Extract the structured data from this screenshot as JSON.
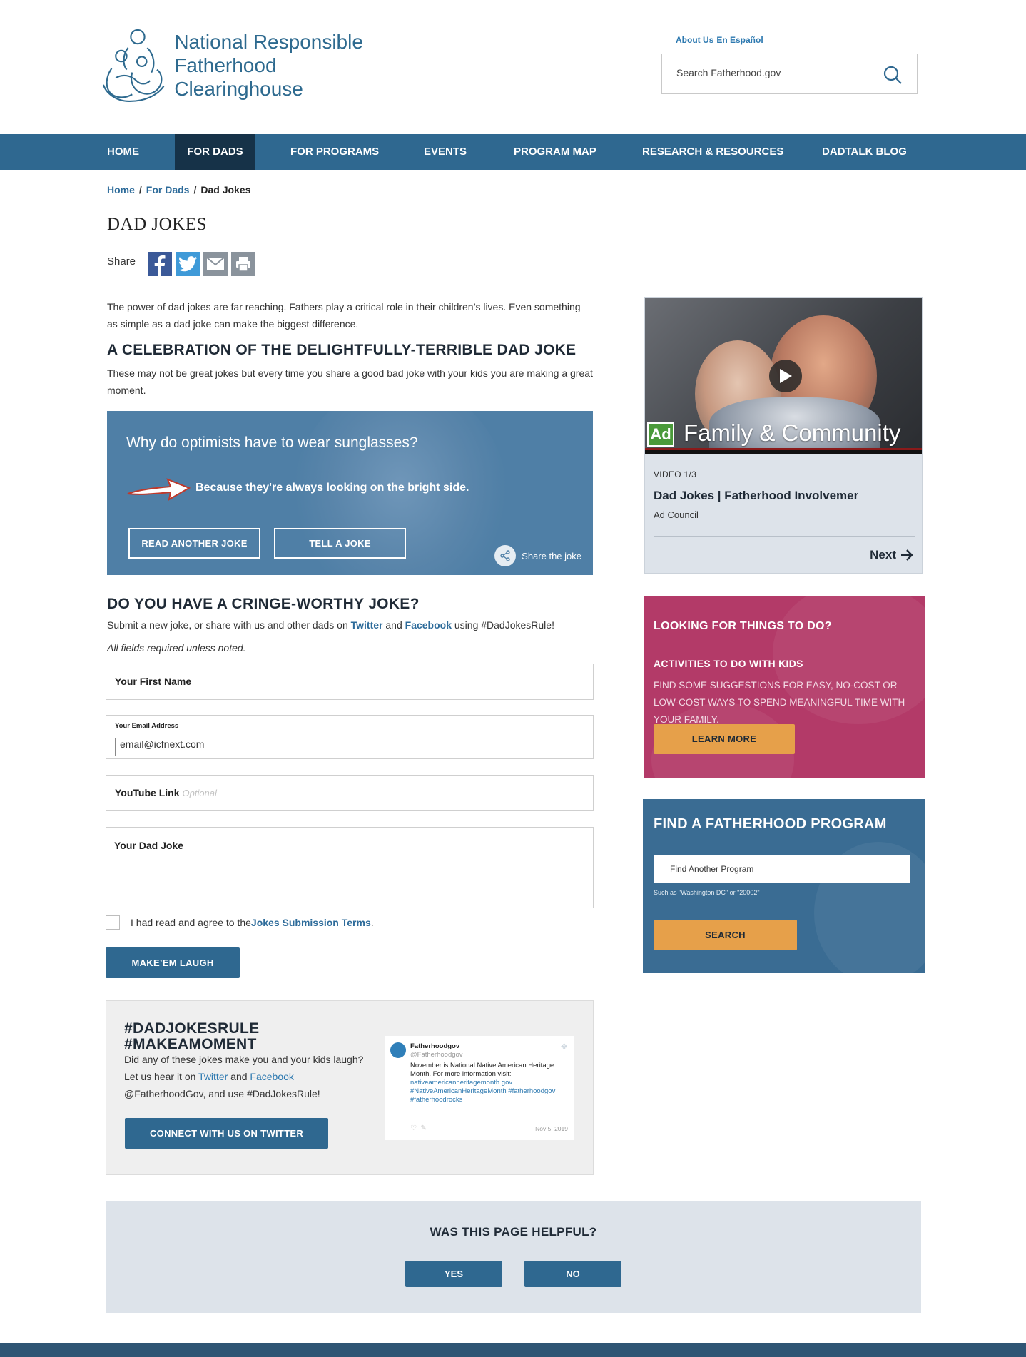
{
  "header": {
    "logo_line1": "National Responsible",
    "logo_line2": "Fatherhood Clearinghouse",
    "top_links": [
      "About Us",
      "En Español"
    ],
    "search_placeholder": "Search Fatherhood.gov"
  },
  "nav": {
    "items": [
      {
        "label": "HOME",
        "active": false
      },
      {
        "label": "FOR DADS",
        "active": true
      },
      {
        "label": "FOR PROGRAMS",
        "active": false
      },
      {
        "label": "EVENTS",
        "active": false
      },
      {
        "label": "PROGRAM MAP",
        "active": false
      },
      {
        "label": "RESEARCH & RESOURCES",
        "active": false
      },
      {
        "label": "DADTALK BLOG",
        "active": false
      }
    ]
  },
  "breadcrumb": {
    "items": [
      "Home",
      "For Dads",
      "Dad Jokes"
    ],
    "separator": "/"
  },
  "page": {
    "title": "DAD JOKES",
    "share_label": "Share",
    "share_icons": [
      "facebook-icon",
      "twitter-icon",
      "email-icon",
      "print-icon"
    ],
    "intro": "The power of dad jokes are far reaching. Fathers play a critical role in their children’s lives. Even something as simple as a dad joke can make the biggest difference.",
    "celebration_title": "A CELEBRATION OF THE DELIGHTFULLY-TERRIBLE DAD JOKE",
    "celebration_text": "These may not be great jokes but every time you share a good bad joke with your kids you are making a great moment."
  },
  "joke": {
    "question": "Why do optimists have to wear sunglasses?",
    "answer": "Because they're always looking on the bright side.",
    "read_another": "READ ANOTHER JOKE",
    "tell_joke": "TELL A JOKE",
    "share": "Share the joke"
  },
  "form": {
    "title": "DO YOU HAVE A CRINGE-WORTHY JOKE?",
    "intro_before": "Submit a new joke, or share with us and other dads on ",
    "intro_twitter": "Twitter",
    "intro_and": " and ",
    "intro_facebook": "Facebook",
    "intro_after": " using #DadJokesRule!",
    "required_note": "All fields required unless noted.",
    "first_name_label": "Your First Name",
    "email_label": "Your Email Address",
    "email_value": "email@icfnext.com",
    "youtube_label": "YouTube Link",
    "youtube_optional": "Optional",
    "joke_label": "Your Dad Joke",
    "terms_before": "I had read and agree to the ",
    "terms_link": "Jokes Submission Terms",
    "terms_after": ".",
    "submit": "MAKE’EM LAUGH"
  },
  "rule": {
    "title_line1": "#DADJOKESRULE",
    "title_line2": "#MAKEAMOMENT",
    "text_1": "Did any of these jokes make you and your kids laugh?",
    "text_2": "Let us hear it on ",
    "text_twitter": "Twitter",
    "text_and": " and ",
    "text_facebook": "Facebook",
    "text_3": "@FatherhoodGov, and use #DadJokesRule!",
    "button": "CONNECT WITH US ON TWITTER",
    "tweet": {
      "name": "Fatherhoodgov",
      "handle": "@Fatherhoodgov",
      "body": "November is National Native American Heritage Month. For more information visit:",
      "link1": "nativeamericanheritagemonth.gov",
      "link2": "#NativeAmericanHeritageMonth #fatherhoodgov",
      "link3": "#fatherhoodrocks",
      "date": "Nov 5, 2019"
    }
  },
  "helpful": {
    "question": "WAS THIS PAGE HELPFUL?",
    "yes": "YES",
    "no": "NO"
  },
  "video": {
    "caption": "Family & Community",
    "ad_badge": "Ad",
    "count": "VIDEO 1/3",
    "title": "Dad Jokes | Fatherhood Involvemer",
    "source": "Ad Council",
    "next": "Next"
  },
  "things": {
    "title": "LOOKING FOR THINGS TO DO?",
    "subtitle": "ACTIVITIES TO DO WITH KIDS",
    "text": "FIND SOME SUGGESTIONS FOR EASY, NO-COST OR LOW-COST WAYS TO SPEND MEANINGFUL TIME WITH YOUR FAMILY.",
    "button": "LEARN MORE"
  },
  "find": {
    "title": "FIND A FATHERHOOD PROGRAM",
    "placeholder": "Find Another Program",
    "hint": "Such as \"Washington DC\" or \"20002\"",
    "button": "SEARCH"
  },
  "colors": {
    "nav_blue": "#2f6890",
    "nav_active": "#163248",
    "link_blue": "#2d6b9a",
    "things_magenta": "#b33a68",
    "find_blue": "#3a6c93",
    "cta_orange": "#e6a04a"
  }
}
